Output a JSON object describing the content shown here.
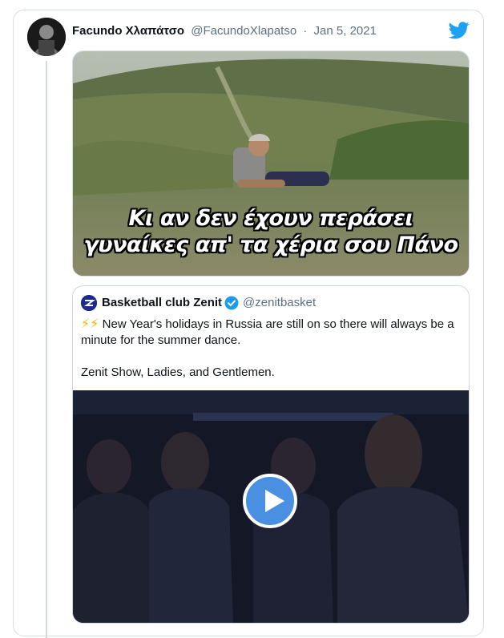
{
  "tweet": {
    "author_name": "Facundo Χλαπάτσο",
    "author_handle": "@FacundoXlapatso",
    "separator": "·",
    "date": "Jan 5, 2021",
    "avatar_icon": "user-avatar",
    "brand_icon": "twitter-bird-icon",
    "brand_color": "#1da1f2",
    "media": {
      "subtitle_line1": "Κι αν δεν έχουν περάσει",
      "subtitle_line2": "γυναίκες απ' τα χέρια σου Πάνο"
    }
  },
  "quoted_tweet": {
    "author_name": "Basketball club Zenit",
    "author_handle": "@zenitbasket",
    "verified_icon": "verified-badge-icon",
    "verified_color": "#1d9bf0",
    "emoji": "⚡⚡",
    "text_line1": "New Year's holidays in Russia are still on so there will always be a minute for the summer dance.",
    "text_line2": "Zenit Show, Ladies, and Gentlemen.",
    "video": {
      "play_icon": "play-icon",
      "play_color": "#4a90e2"
    }
  }
}
